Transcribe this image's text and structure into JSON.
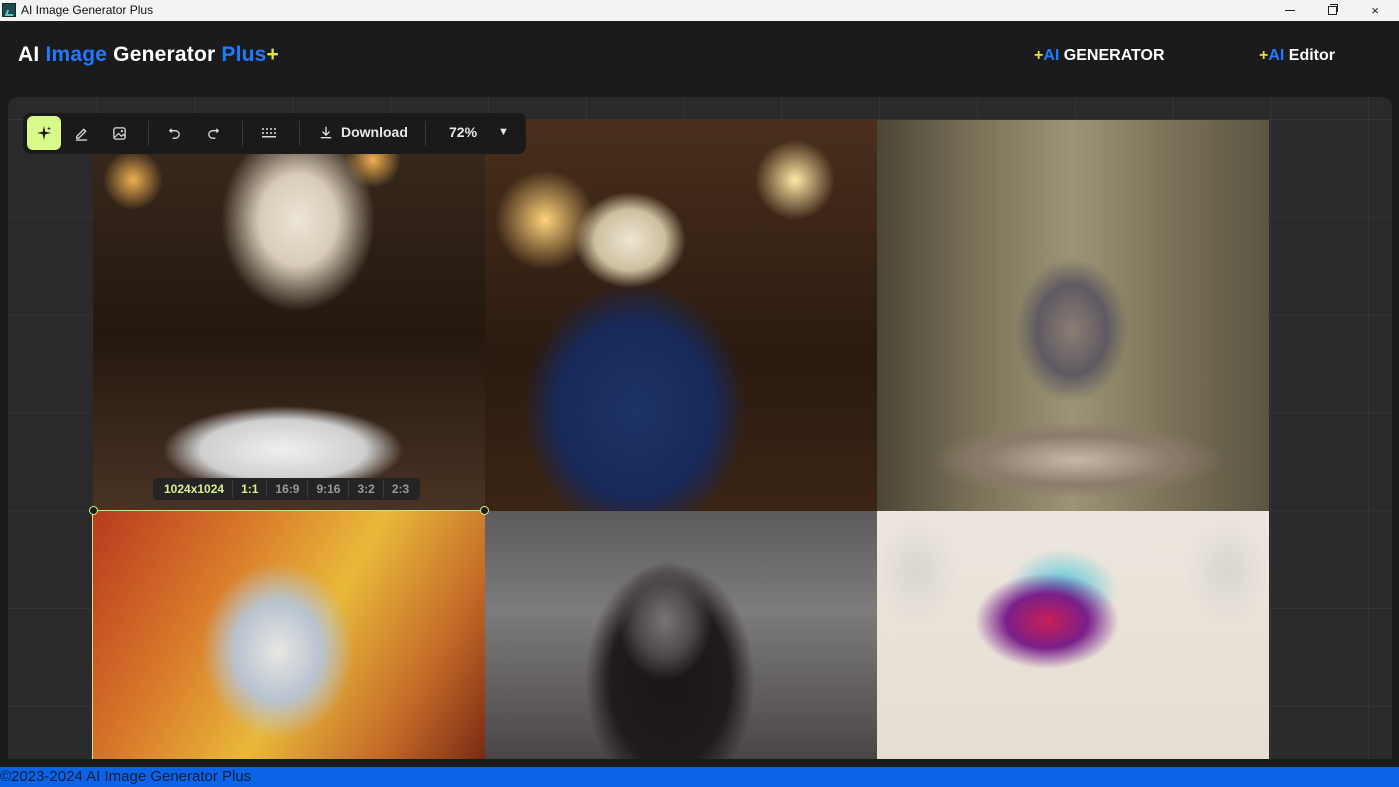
{
  "window": {
    "title": "AI Image Generator Plus",
    "minimize_label": "minimize",
    "maximize_label": "restore",
    "close_label": "×"
  },
  "header": {
    "brand": {
      "part1": "AI ",
      "part2": "Image",
      "part3": " Generator ",
      "part4": "Plus",
      "part5": "+"
    },
    "nav": {
      "generator": {
        "plus": "+",
        "ai": "AI",
        "label": " GENERATOR"
      },
      "editor": {
        "plus": "+",
        "ai": "AI",
        "label": " Editor"
      }
    }
  },
  "toolbar": {
    "tools": [
      {
        "name": "magic-tool",
        "icon": "sparkle-icon",
        "active": true
      },
      {
        "name": "edit-tool",
        "icon": "pencil-icon",
        "active": false
      },
      {
        "name": "image-tool",
        "icon": "image-icon",
        "active": false
      },
      {
        "name": "undo",
        "icon": "undo-icon",
        "active": false
      },
      {
        "name": "redo",
        "icon": "redo-icon",
        "active": false
      },
      {
        "name": "grid-tool",
        "icon": "dots-grid-icon",
        "active": false
      }
    ],
    "download_label": "Download",
    "zoom_value": "72%"
  },
  "canvas": {
    "images": [
      {
        "subject": "skeleton eating noodles"
      },
      {
        "subject": "skeleton in blue suit"
      },
      {
        "subject": "zombies eating cakes"
      },
      {
        "subject": "painted skull"
      },
      {
        "subject": "woman with red eyes"
      },
      {
        "subject": "dripping skulls"
      }
    ],
    "ratio_bar": {
      "resolution": "1024x1024",
      "options": [
        "1:1",
        "16:9",
        "9:16",
        "3:2",
        "2:3"
      ],
      "selected": "1:1"
    }
  },
  "footer": {
    "text": "©2023-2024 AI Image Generator Plus"
  },
  "colors": {
    "accent_blue": "#1e7bff",
    "accent_yellow": "#e6e23c",
    "active_tool": "#d9f98a",
    "footer_bg": "#0b63e8"
  }
}
